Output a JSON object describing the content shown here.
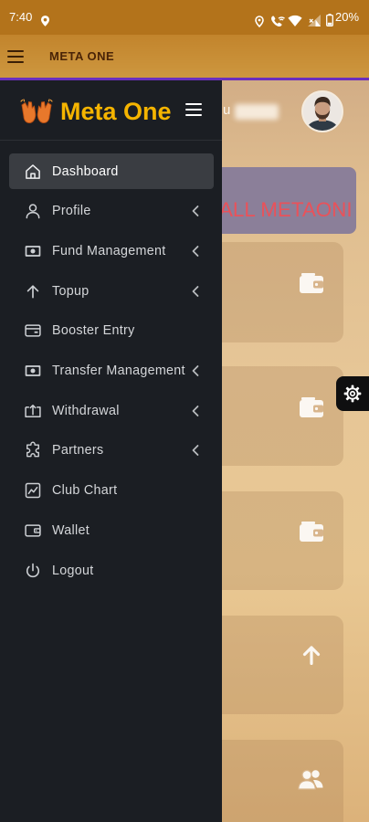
{
  "status_bar": {
    "time": "7:40",
    "battery": "20%",
    "icons": [
      "location-icon",
      "location-outline-icon",
      "wifi-calling-icon",
      "wifi-icon",
      "signal-icon",
      "battery-icon"
    ]
  },
  "app_bar": {
    "title": "META ONE",
    "menu_icon": "hamburger-icon"
  },
  "drawer": {
    "brand": "Meta One",
    "logo_icon": "raised-hands-logo-icon",
    "toggle_icon": "hamburger-icon",
    "items": [
      {
        "label": "Dashboard",
        "icon": "home-icon",
        "active": true,
        "has_submenu": false
      },
      {
        "label": "Profile",
        "icon": "user-icon",
        "active": false,
        "has_submenu": true
      },
      {
        "label": "Fund Management",
        "icon": "money-icon",
        "active": false,
        "has_submenu": true
      },
      {
        "label": "Topup",
        "icon": "arrow-up-icon",
        "active": false,
        "has_submenu": true
      },
      {
        "label": "Booster Entry",
        "icon": "card-icon",
        "active": false,
        "has_submenu": false
      },
      {
        "label": "Transfer Management",
        "icon": "money-icon",
        "active": false,
        "has_submenu": true
      },
      {
        "label": "Withdrawal",
        "icon": "withdraw-icon",
        "active": false,
        "has_submenu": true
      },
      {
        "label": "Partners",
        "icon": "puzzle-icon",
        "active": false,
        "has_submenu": true
      },
      {
        "label": "Club Chart",
        "icon": "chart-icon",
        "active": false,
        "has_submenu": false
      },
      {
        "label": "Wallet",
        "icon": "wallet-icon",
        "active": false,
        "has_submenu": false
      },
      {
        "label": "Logout",
        "icon": "power-icon",
        "active": false,
        "has_submenu": false
      }
    ]
  },
  "header": {
    "username": "u",
    "avatar_icon": "avatar-photo"
  },
  "banner": {
    "text": "ALL METAONI"
  },
  "cards": [
    {
      "icon": "wallet-icon"
    },
    {
      "icon": "wallet-icon"
    },
    {
      "icon": "wallet-icon"
    },
    {
      "icon": "arrow-up-icon"
    },
    {
      "icon": "users-icon"
    }
  ],
  "floating_button": {
    "icon": "gear-icon"
  },
  "colors": {
    "status_bar": "#b3731b",
    "app_bar": "#c88d33",
    "app_title": "#4a2407",
    "purple_rule": "#6a2fbd",
    "drawer_bg": "#1b1e23",
    "active_item_bg": "#3a3d42",
    "brand_yellow": "#f5b400",
    "logo_orange": "#e8782b",
    "banner_bg": "#8b7f99",
    "banner_text": "#e9525a",
    "fab_bg": "#0f0f10"
  }
}
